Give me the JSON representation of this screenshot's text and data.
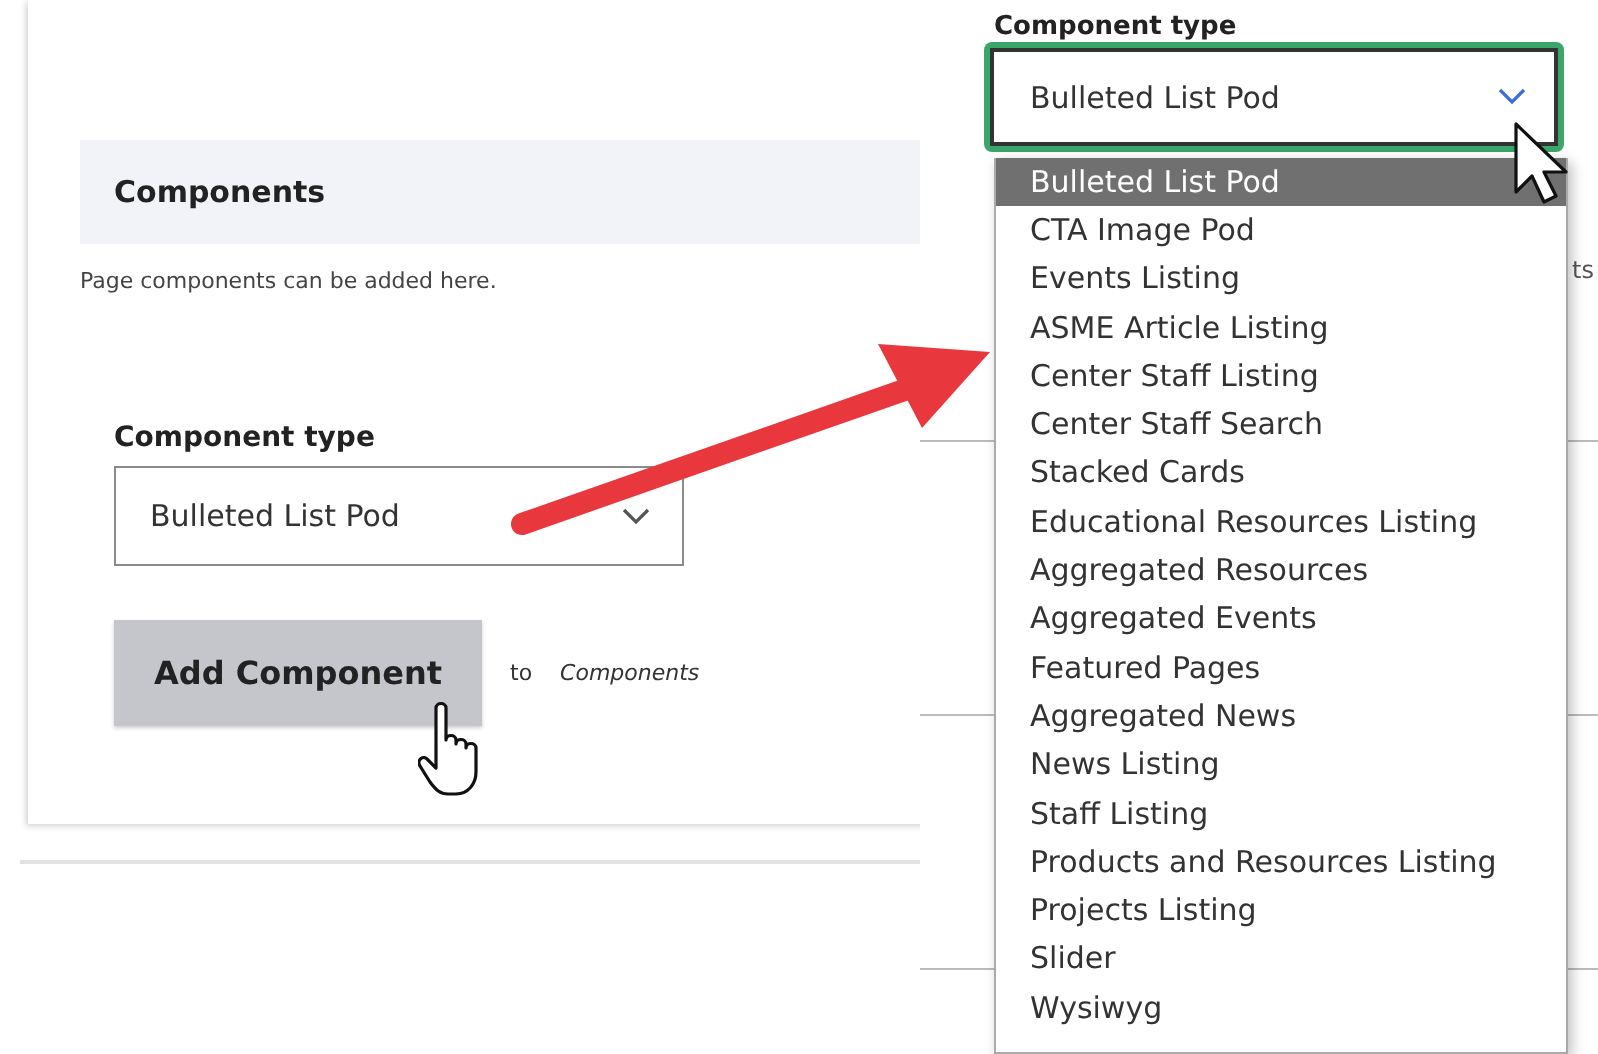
{
  "form": {
    "section_title": "Components",
    "help_text": "Page components can be added here.",
    "field_label": "Component type",
    "select_value": "Bulleted List Pod",
    "button": "Add Component",
    "target_prefix": "to",
    "target": "Components"
  },
  "dropdown": {
    "field_label": "Component type",
    "select_value": "Bulleted List Pod",
    "focused": true,
    "background_text": "ts",
    "options": [
      {
        "label": "Bulleted List Pod",
        "selected": true
      },
      {
        "label": "CTA Image Pod",
        "selected": false
      },
      {
        "label": "Events Listing",
        "selected": false
      },
      {
        "label": "ASME Article Listing",
        "selected": false
      },
      {
        "label": "Center Staff Listing",
        "selected": false
      },
      {
        "label": "Center Staff Search",
        "selected": false
      },
      {
        "label": "Stacked Cards",
        "selected": false
      },
      {
        "label": "Educational Resources Listing",
        "selected": false
      },
      {
        "label": "Aggregated Resources",
        "selected": false
      },
      {
        "label": "Aggregated Events",
        "selected": false
      },
      {
        "label": "Featured Pages",
        "selected": false
      },
      {
        "label": "Aggregated News",
        "selected": false
      },
      {
        "label": "News Listing",
        "selected": false
      },
      {
        "label": "Staff Listing",
        "selected": false
      },
      {
        "label": "Products and Resources Listing",
        "selected": false
      },
      {
        "label": "Projects Listing",
        "selected": false
      },
      {
        "label": "Slider",
        "selected": false
      },
      {
        "label": "Wysiwyg",
        "selected": false
      }
    ]
  }
}
